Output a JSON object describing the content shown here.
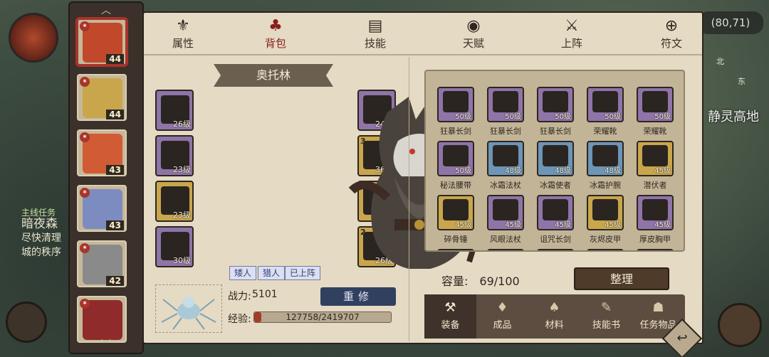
{
  "hud": {
    "left_line1": "暗夜森",
    "left_line2": "尽快清理",
    "left_line3": "城的秩序",
    "left_hint": "主线任务",
    "coords": "(80,71)",
    "compass_n": "北",
    "compass_e": "东",
    "location": "静灵高地"
  },
  "heroes": [
    {
      "level": "44",
      "portrait_color": "#c2482c",
      "badge_color": "#a8342a",
      "selected": true
    },
    {
      "level": "44",
      "portrait_color": "#c9a64c",
      "badge_color": "#a8342a",
      "selected": false
    },
    {
      "level": "43",
      "portrait_color": "#d15b35",
      "badge_color": "#a8342a",
      "selected": false
    },
    {
      "level": "43",
      "portrait_color": "#7d8cc0",
      "badge_color": "#a8342a",
      "selected": false
    },
    {
      "level": "42",
      "portrait_color": "#8a8a8a",
      "badge_color": "#a8342a",
      "selected": false
    },
    {
      "level": "",
      "portrait_color": "#8f2b2b",
      "badge_color": "#a8342a",
      "selected": false
    }
  ],
  "tabs": [
    {
      "label": "属性",
      "icon": "⚜",
      "active": false
    },
    {
      "label": "背包",
      "icon": "♣",
      "active": true
    },
    {
      "label": "技能",
      "icon": "▤",
      "active": false
    },
    {
      "label": "天赋",
      "icon": "◉",
      "active": false
    },
    {
      "label": "上阵",
      "icon": "⚔",
      "active": false
    },
    {
      "label": "符文",
      "icon": "⊕",
      "active": false
    }
  ],
  "hero": {
    "name": "奥托林",
    "traits": [
      "矮人",
      "猎人",
      "已上阵"
    ],
    "power_label": "战力:",
    "power_value": "5101",
    "rebuild_label": "重修",
    "xp_label": "经验:",
    "xp_text": "127758/2419707",
    "xp_fraction": 0.053
  },
  "equipment_left": [
    {
      "level": "26级",
      "rarity": "purple",
      "count": ""
    },
    {
      "level": "23级",
      "rarity": "purple",
      "count": ""
    },
    {
      "level": "23级",
      "rarity": "gold",
      "count": ""
    },
    {
      "level": "30级",
      "rarity": "purple",
      "count": ""
    }
  ],
  "equipment_right": [
    {
      "level": "24级",
      "rarity": "purple",
      "count": ""
    },
    {
      "level": "36级",
      "rarity": "gold",
      "count": "3"
    },
    {
      "level": "22级",
      "rarity": "gold",
      "count": ""
    },
    {
      "level": "26级",
      "rarity": "gold",
      "count": "2"
    }
  ],
  "inventory": [
    {
      "name": "狂暴长剑",
      "level": "50级",
      "rarity": "purple"
    },
    {
      "name": "狂暴长剑",
      "level": "50级",
      "rarity": "purple"
    },
    {
      "name": "狂暴长剑",
      "level": "50级",
      "rarity": "purple"
    },
    {
      "name": "荣耀靴",
      "level": "50级",
      "rarity": "purple"
    },
    {
      "name": "荣耀靴",
      "level": "50级",
      "rarity": "purple"
    },
    {
      "name": "秘法腰带",
      "level": "50级",
      "rarity": "purple"
    },
    {
      "name": "冰霜法杖",
      "level": "48级",
      "rarity": "blue"
    },
    {
      "name": "冰霜使者",
      "level": "48级",
      "rarity": "blue"
    },
    {
      "name": "冰霜护腕",
      "level": "48级",
      "rarity": "blue"
    },
    {
      "name": "潜伏者",
      "level": "45级",
      "rarity": "gold"
    },
    {
      "name": "碎骨锤",
      "level": "45级",
      "rarity": "gold"
    },
    {
      "name": "风眼法杖",
      "level": "45级",
      "rarity": "purple"
    },
    {
      "name": "诅咒长剑",
      "level": "45级",
      "rarity": "purple"
    },
    {
      "name": "灰烬皮甲",
      "level": "45级",
      "rarity": "gold"
    },
    {
      "name": "厚皮胸甲",
      "level": "45级",
      "rarity": "purple"
    },
    {
      "name": "",
      "level": "",
      "rarity": "purple"
    },
    {
      "name": "",
      "level": "",
      "rarity": "purple"
    },
    {
      "name": "",
      "level": "",
      "rarity": "blue"
    },
    {
      "name": "",
      "level": "",
      "rarity": "purple"
    },
    {
      "name": "",
      "level": "",
      "rarity": "purple"
    }
  ],
  "capacity": {
    "label": "容量:",
    "value": "69/100"
  },
  "sort_label": "整理",
  "bag_tabs": [
    {
      "label": "装备",
      "icon": "⚒",
      "active": true
    },
    {
      "label": "成品",
      "icon": "♦",
      "active": false
    },
    {
      "label": "材料",
      "icon": "♠",
      "active": false
    },
    {
      "label": "技能书",
      "icon": "✎",
      "active": false
    },
    {
      "label": "任务物品",
      "icon": "☗",
      "active": false
    }
  ],
  "colors": {
    "purple": "#8f74a8",
    "gold": "#c9a64c",
    "blue": "#6c95b7",
    "accent_red": "#8c1f1f"
  }
}
